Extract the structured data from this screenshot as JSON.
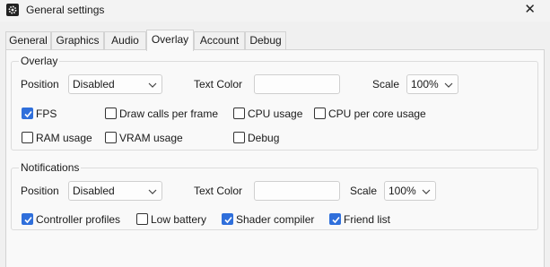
{
  "window": {
    "title": "General settings",
    "close_glyph": "✕"
  },
  "tabs": [
    "General",
    "Graphics",
    "Audio",
    "Overlay",
    "Account",
    "Debug"
  ],
  "overlay": {
    "title": "Overlay",
    "position_label": "Position",
    "position_value": "Disabled",
    "text_color_label": "Text Color",
    "text_color_value": "",
    "scale_label": "Scale",
    "scale_value": "100%",
    "checkboxes": [
      {
        "label": "FPS",
        "checked": true
      },
      {
        "label": "Draw calls per frame",
        "checked": false
      },
      {
        "label": "CPU usage",
        "checked": false
      },
      {
        "label": "CPU per core usage",
        "checked": false
      },
      {
        "label": "RAM usage",
        "checked": false
      },
      {
        "label": "VRAM usage",
        "checked": false
      },
      {
        "label": "Debug",
        "checked": false
      }
    ]
  },
  "notifications": {
    "title": "Notifications",
    "position_label": "Position",
    "position_value": "Disabled",
    "text_color_label": "Text Color",
    "text_color_value": "",
    "scale_label": "Scale",
    "scale_value": "100%",
    "checkboxes": [
      {
        "label": "Controller profiles",
        "checked": true
      },
      {
        "label": "Low battery",
        "checked": false
      },
      {
        "label": "Shader compiler",
        "checked": true
      },
      {
        "label": "Friend list",
        "checked": true
      }
    ]
  },
  "colors": {
    "accent": "#2f6fdb",
    "active_tab": "Overlay"
  },
  "icons": {
    "app": "gear-icon",
    "close": "close-icon",
    "chevron": "chevron-down-icon",
    "check": "checkmark-icon"
  }
}
